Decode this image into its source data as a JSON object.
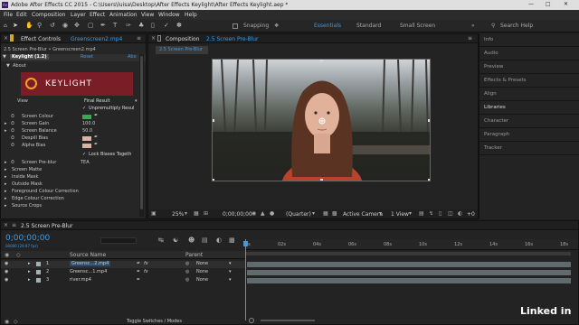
{
  "window": {
    "title": "Adobe After Effects CC 2015 - C:\\Users\\luisa\\Desktop\\After Effects Keylight\\After Effects Keylight.aep *"
  },
  "menu": [
    "File",
    "Edit",
    "Composition",
    "Layer",
    "Effect",
    "Animation",
    "View",
    "Window",
    "Help"
  ],
  "toolbar": {
    "snapping": "Snapping",
    "workspaces": [
      "Essentials",
      "Standard",
      "Small Screen"
    ],
    "search_help": "Search Help"
  },
  "effect_controls": {
    "tab_label": "Effect Controls",
    "tab_clip": "Greenscreen2.mp4",
    "breadcrumb": "2.5 Screen Pre-Blur • Greenscreen2.mp4",
    "effect_name": "Keylight (1.2)",
    "reset": "Reset",
    "about_link": "Abo",
    "about": "About",
    "logo_text": "KEYLIGHT",
    "view_label": "View",
    "view_value": "Final Result",
    "unpremultiply": "Unpremultiply Resul",
    "screen_colour": "Screen Colour",
    "screen_gain": "Screen Gain",
    "screen_gain_value": "100.0",
    "screen_balance": "Screen Balance",
    "screen_balance_value": "50.0",
    "despill_bias": "Despill Bias",
    "alpha_bias": "Alpha Bias",
    "lock_biases": "Lock Biases Togeth",
    "screen_preblur": "Screen Pre-blur",
    "screen_preblur_value": "TEA",
    "groups": [
      "Screen Matte",
      "Inside Mask",
      "Outside Mask",
      "Foreground Colour Correction",
      "Edge Colour Correction",
      "Source Crops"
    ],
    "screen_colour_hex": "#39a852",
    "despill_hex": "#d8b3a8",
    "alpha_hex": "#d8b3a8"
  },
  "composition": {
    "tab_label": "Composition",
    "tab_name": "2.5 Screen Pre-Blur",
    "sub_tab": "2.5 Screen Pre-Blur",
    "zoom": "25%",
    "timecode": "0;00;00;00",
    "resolution": "(Quarter)",
    "camera": "Active Camera",
    "view": "1 View"
  },
  "right_panels": [
    "Info",
    "Audio",
    "Preview",
    "Effects & Presets",
    "Align",
    "Libraries",
    "Character",
    "Paragraph",
    "Tracker"
  ],
  "timeline": {
    "tab_label": "2.5 Screen Pre-Blur",
    "timecode": "0;00;00;00",
    "fps": "00000 (29.97 fps)",
    "column_source": "Source Name",
    "column_parent": "Parent",
    "ruler": [
      "0s",
      "02s",
      "04s",
      "06s",
      "08s",
      "10s",
      "12s",
      "14s",
      "16s",
      "18s"
    ],
    "layers": [
      {
        "num": "1",
        "name": "Greensc...2.mp4",
        "parent": "None"
      },
      {
        "num": "2",
        "name": "Greensc...1.mp4",
        "parent": "None"
      },
      {
        "num": "3",
        "name": "river.mp4",
        "parent": "None"
      }
    ],
    "toggle": "Toggle Switches / Modes"
  },
  "watermark": "Linked in"
}
